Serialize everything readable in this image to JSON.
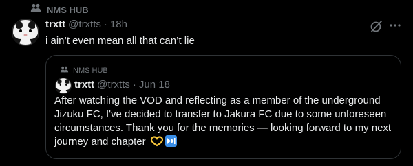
{
  "community": {
    "label": "NMS HUB",
    "icon": "people-icon"
  },
  "post": {
    "display_name": "trxtt",
    "handle": "@trxtts",
    "dot": "·",
    "time": "18h",
    "text": "i ain’t even mean all that can’t lie",
    "actions": {
      "grok_icon": "grok-icon",
      "more_icon": "more-icon"
    }
  },
  "quoted_post": {
    "community_label": "NMS HUB",
    "display_name": "trxtt",
    "handle": "@trxtts",
    "dot": "·",
    "time": "Jun 18",
    "text": "After watching the VOD and reflecting as a member of the underground Jizuku FC, I've decided to transfer to Jakura FC due to some unforeseen circumstances. Thank you for the memories — looking forward to my next journey and chapter",
    "emojis": [
      "heart-hands-emoji",
      "next-track-emoji"
    ]
  },
  "colors": {
    "background": "#000000",
    "text": "#e7e9ea",
    "muted": "#71767b",
    "border": "#2f3336",
    "emoji_blue": "#3a8ee6",
    "emoji_yellow": "#f7c63b"
  }
}
